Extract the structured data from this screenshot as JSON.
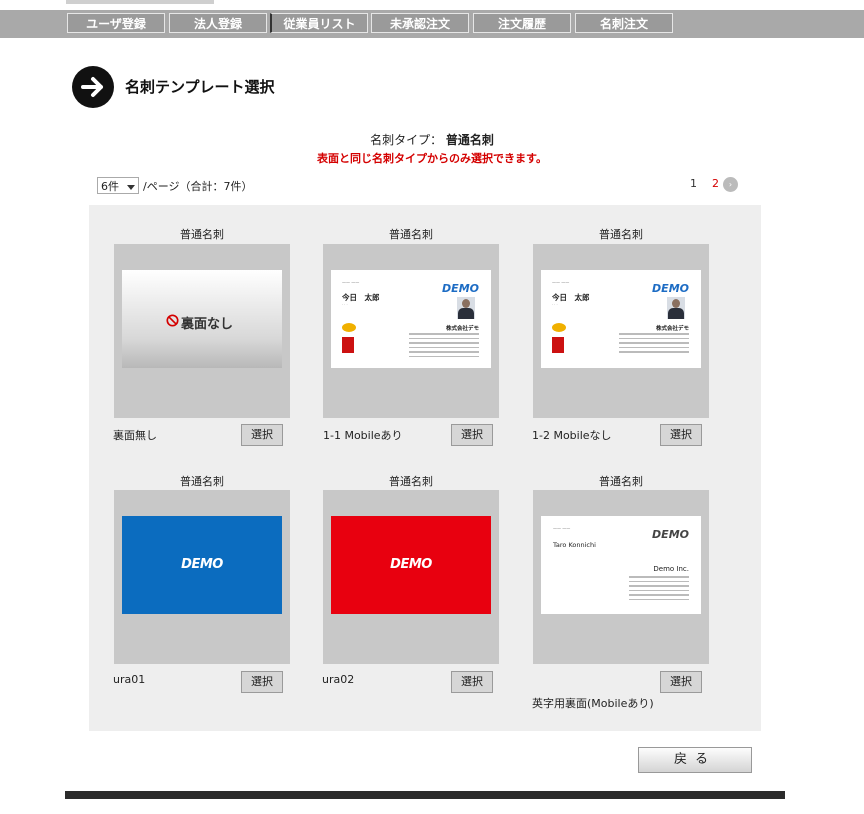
{
  "nav": {
    "tabs": [
      {
        "label": "ユーザ登録"
      },
      {
        "label": "法人登録"
      },
      {
        "label": "従業員リスト"
      },
      {
        "label": "未承認注文"
      },
      {
        "label": "注文履歴"
      },
      {
        "label": "名刺注文"
      }
    ]
  },
  "page": {
    "title": "名刺テンプレート選択",
    "type_label": "名刺タイプ：",
    "type_value": "普通名刺",
    "warning": "表面と同じ名刺タイプからのみ選択できます。"
  },
  "pagination": {
    "per_page_value": "6件",
    "per_page_suffix": "/ページ（合計：7件）",
    "pages": [
      "1",
      "2"
    ],
    "current_page": "2",
    "next_icon": "next-arrow-icon"
  },
  "cards": [
    {
      "type": "普通名刺",
      "name": "裏面無し",
      "select_label": "選択",
      "preview_text": "裏面なし"
    },
    {
      "type": "普通名刺",
      "name": "1-1 Mobileあり",
      "select_label": "選択",
      "preview_logo": "DEMO",
      "preview_person": "今日　太郎",
      "preview_company": "株式会社デモ"
    },
    {
      "type": "普通名刺",
      "name": "1-2 Mobileなし",
      "select_label": "選択",
      "preview_logo": "DEMO",
      "preview_person": "今日　太郎",
      "preview_company": "株式会社デモ"
    },
    {
      "type": "普通名刺",
      "name": "ura01",
      "select_label": "選択",
      "preview_logo": "DEMO",
      "preview_color": "#0b6cbf"
    },
    {
      "type": "普通名刺",
      "name": "ura02",
      "select_label": "選択",
      "preview_logo": "DEMO",
      "preview_color": "#e8000f"
    },
    {
      "type": "普通名刺",
      "name": "英字用裏面(Mobileあり)",
      "select_label": "選択",
      "preview_logo": "DEMO",
      "preview_person": "Taro Konnichi",
      "preview_company": "Demo Inc."
    }
  ],
  "footer": {
    "back_label": "戻る"
  },
  "colors": {
    "warning": "#d40000",
    "nav_bg": "#a9a9a9",
    "panel_bg": "#eeeeee"
  }
}
